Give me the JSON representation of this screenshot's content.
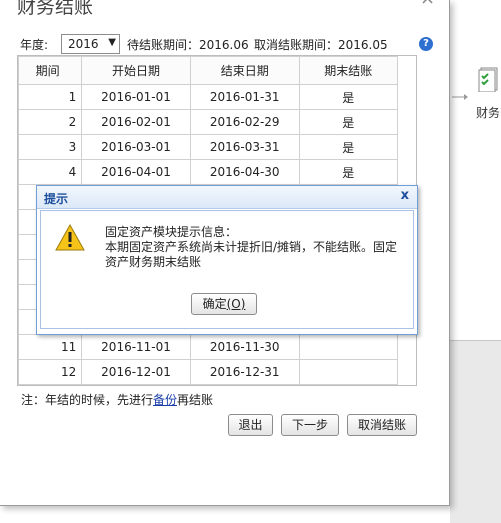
{
  "background_app": {
    "label": "财务"
  },
  "dialog": {
    "title": "财务结账",
    "close_glyph": "×",
    "year_label": "年度:",
    "year_value": "2016",
    "pending_text": "待结账期间：2016.06",
    "cancel_period_text": "取消结账期间：2016.05",
    "help_glyph": "?"
  },
  "table": {
    "headers": [
      "期间",
      "开始日期",
      "结束日期",
      "期末结账"
    ],
    "rows": [
      [
        "1",
        "2016-01-01",
        "2016-01-31",
        "是"
      ],
      [
        "2",
        "2016-02-01",
        "2016-02-29",
        "是"
      ],
      [
        "3",
        "2016-03-01",
        "2016-03-31",
        "是"
      ],
      [
        "4",
        "2016-04-01",
        "2016-04-30",
        "是"
      ],
      [
        "",
        "",
        "",
        ""
      ],
      [
        "",
        "",
        "",
        ""
      ],
      [
        "",
        "",
        "",
        ""
      ],
      [
        "",
        "",
        "",
        ""
      ],
      [
        "",
        "",
        "",
        ""
      ],
      [
        "",
        "",
        "",
        ""
      ],
      [
        "11",
        "2016-11-01",
        "2016-11-30",
        ""
      ],
      [
        "12",
        "2016-12-01",
        "2016-12-31",
        ""
      ]
    ]
  },
  "note": {
    "prefix": "注：年结的时候，先进行",
    "link": "备份",
    "suffix": "再结账"
  },
  "buttons": {
    "exit": "退出",
    "next": "下一步",
    "cancel": "取消结账"
  },
  "alert": {
    "title": "提示",
    "close_glyph": "x",
    "line1": "固定资产模块提示信息：",
    "line2": "本期固定资产系统尚未计提折旧/摊销，不能结账。固定资产财务期末结账",
    "ok_label": "确定",
    "ok_hotkey": "(O)"
  }
}
